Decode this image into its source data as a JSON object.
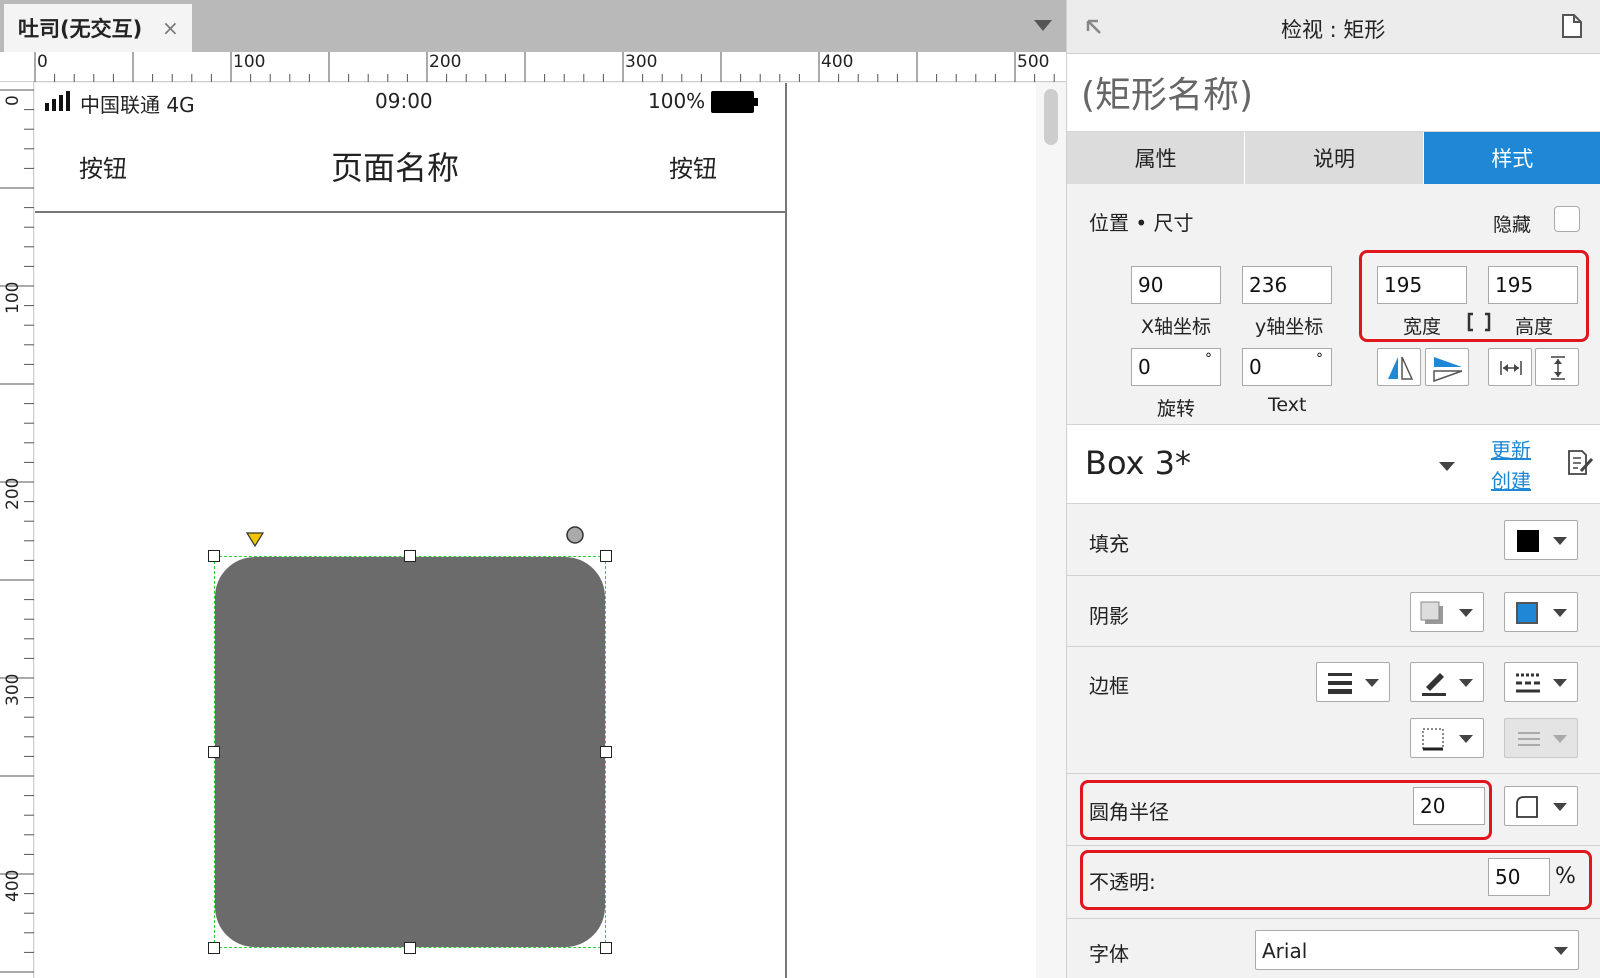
{
  "doc_tab": {
    "title": "吐司(无交互)",
    "close": "×"
  },
  "ruler": {
    "h_labels": [
      "0",
      "100",
      "200",
      "300",
      "400",
      "500"
    ],
    "v_labels": [
      "0",
      "100",
      "200",
      "300",
      "400"
    ]
  },
  "phone": {
    "carrier": "中国联通 4G",
    "time": "09:00",
    "battery": "100%",
    "nav_left": "按钮",
    "nav_title": "页面名称",
    "nav_right": "按钮"
  },
  "inspector": {
    "title": "检视 : 矩形",
    "shape_name": "(矩形名称)",
    "tabs": [
      {
        "label": "属性",
        "active": false
      },
      {
        "label": "说明",
        "active": false
      },
      {
        "label": "样式",
        "active": true
      }
    ],
    "position_section": "位置 • 尺寸",
    "hidden_label": "隐藏",
    "x": {
      "value": "90",
      "label": "X轴坐标"
    },
    "y": {
      "value": "236",
      "label": "y轴坐标"
    },
    "width": {
      "value": "195",
      "label": "宽度"
    },
    "height": {
      "value": "195",
      "label": "高度"
    },
    "rotation": {
      "value": "0",
      "unit": "°",
      "label": "旋转"
    },
    "text_rotation": {
      "value": "0",
      "unit": "°",
      "label": "Text"
    },
    "style_name": "Box 3*",
    "update_link": "更新",
    "create_link": "创建",
    "fill_label": "填充",
    "shadow_label": "阴影",
    "border_label": "边框",
    "corner_radius": {
      "label": "圆角半径",
      "value": "20"
    },
    "opacity": {
      "label": "不透明:",
      "value": "50",
      "unit": "%"
    },
    "font": {
      "label": "字体",
      "value": "Arial"
    },
    "colors": {
      "accent": "#1e88d6",
      "highlight": "#e0161e",
      "fill_swatch": "#000000",
      "shadow_swatch": "#1e88d6",
      "shape_fill": "#6b6b6b"
    }
  }
}
